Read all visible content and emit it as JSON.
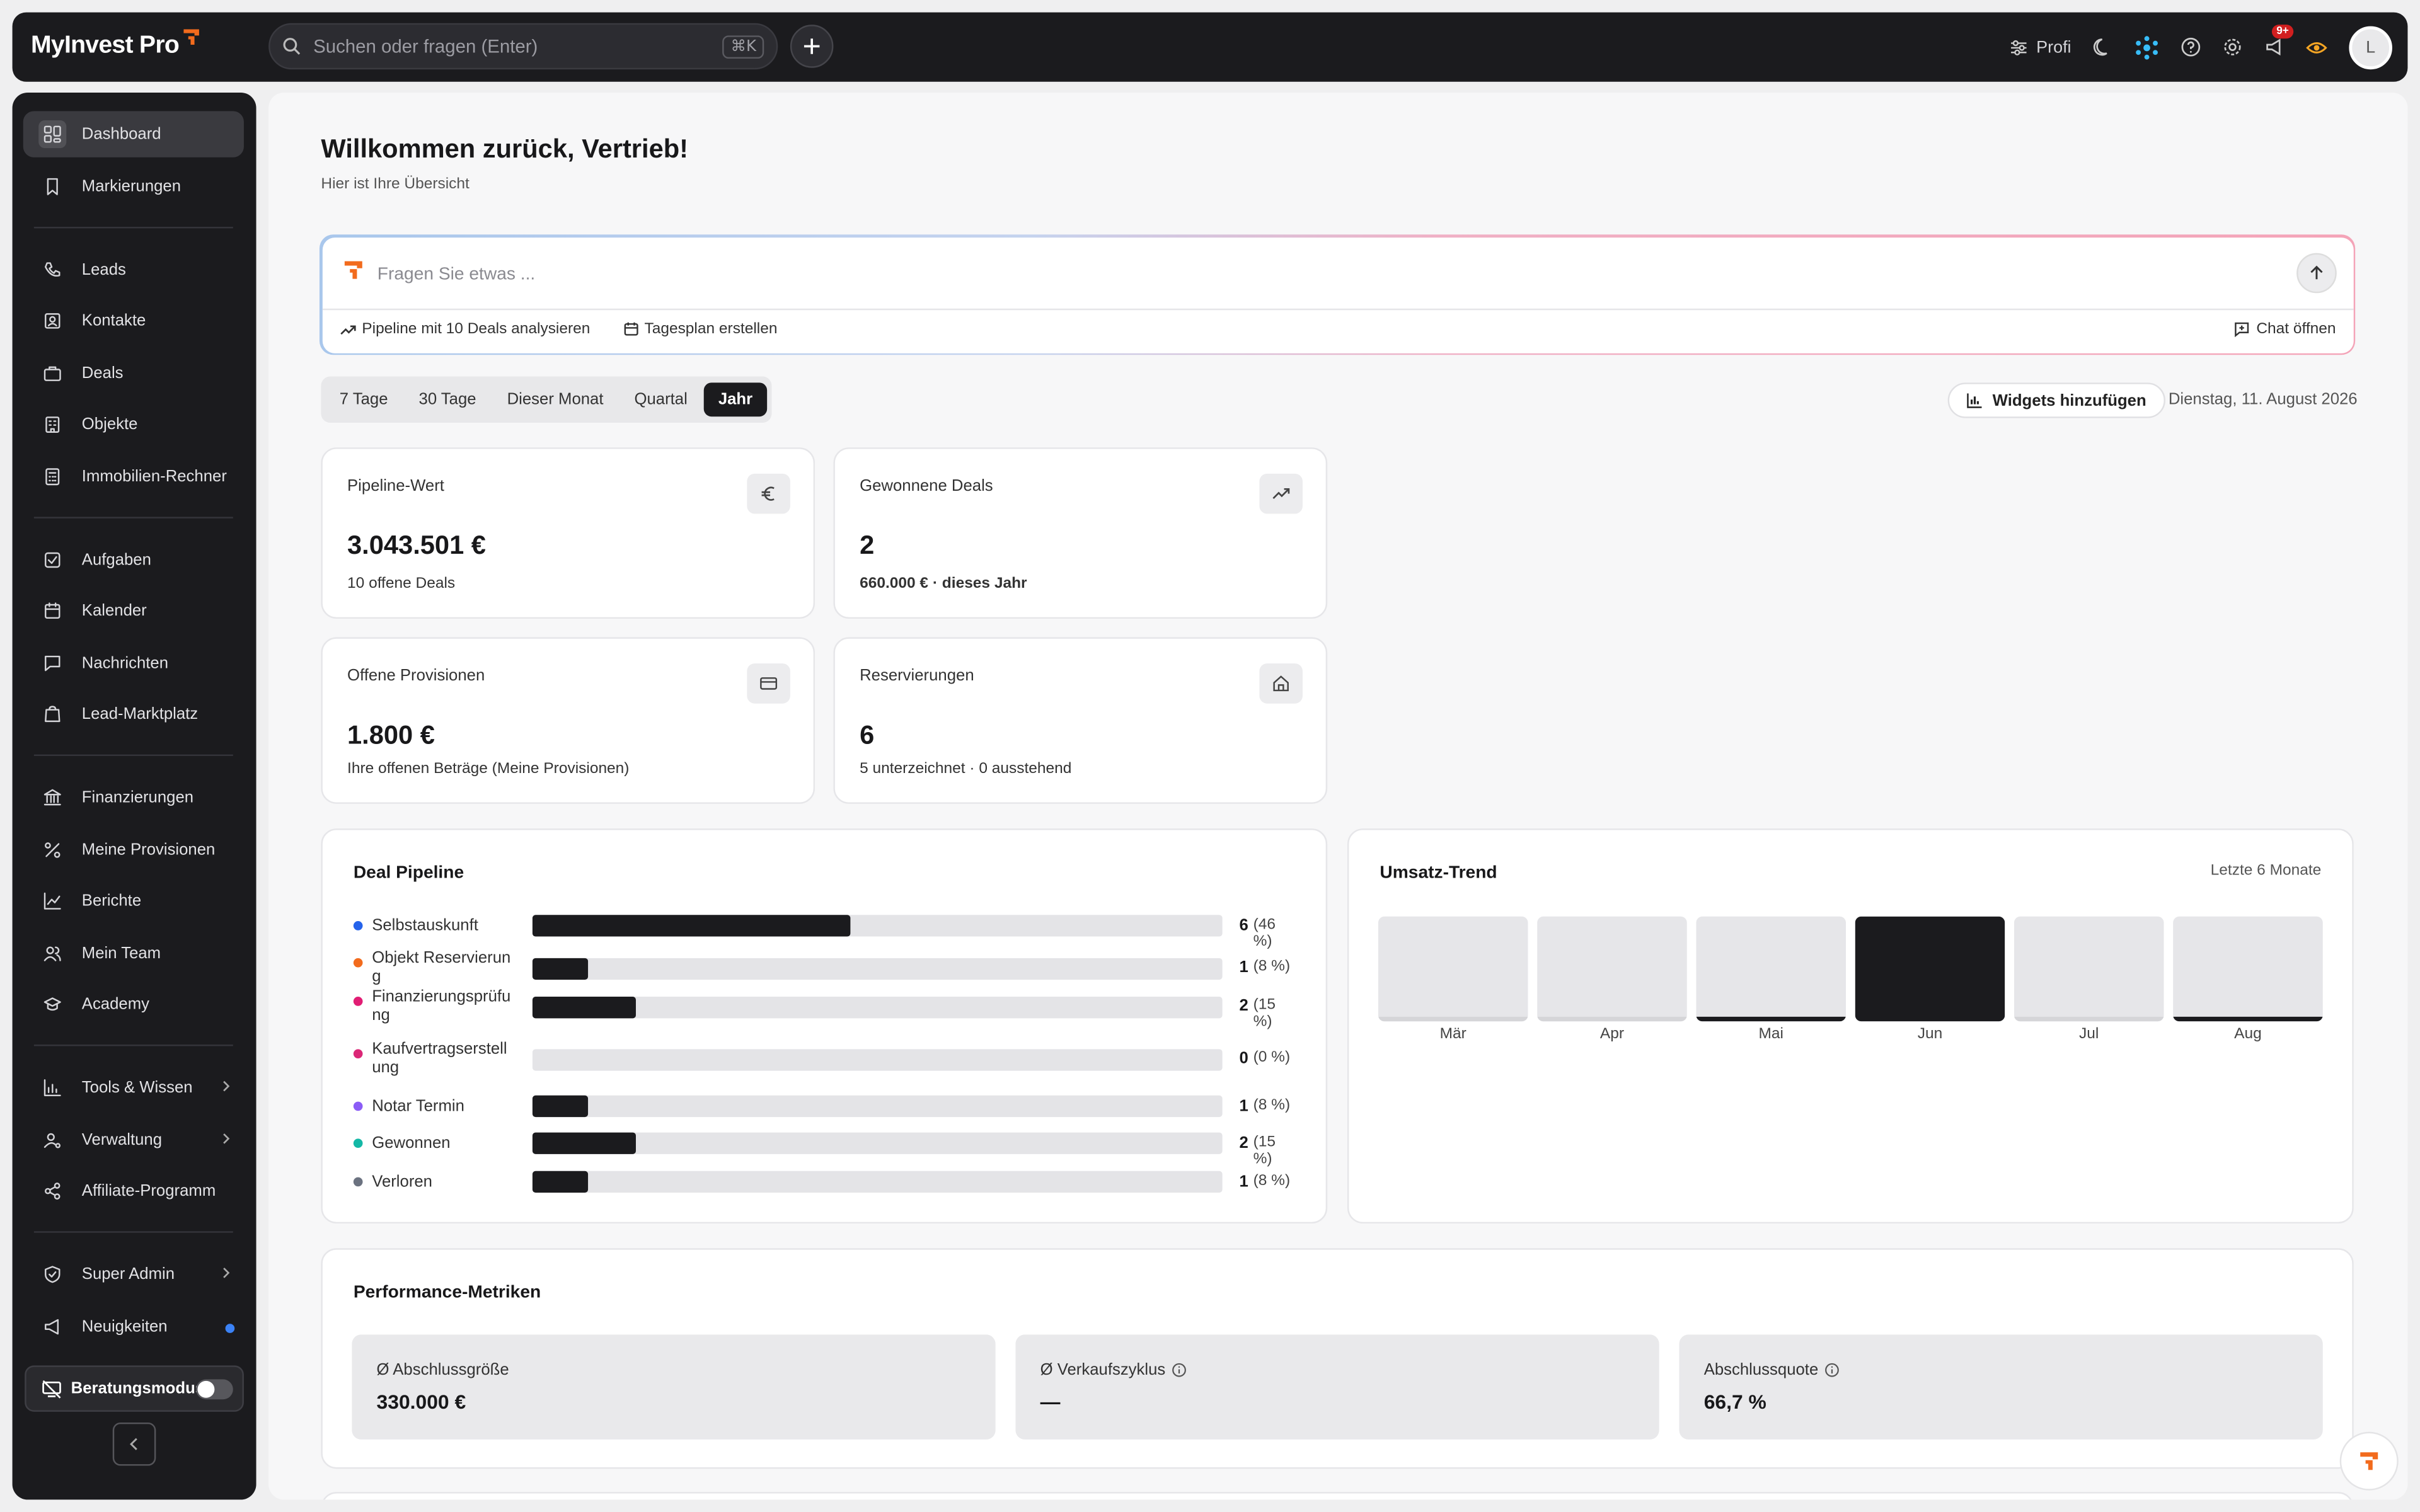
{
  "app": {
    "brand": "MyInvest Pro",
    "accent": "#f26b1d"
  },
  "header": {
    "search_placeholder": "Suchen oder fragen (Enter)",
    "shortcut": "⌘K",
    "profile_mode": "Profi",
    "notification_count": "9+",
    "avatar_initial": "L"
  },
  "sidebar": {
    "groups": [
      [
        {
          "label": "Dashboard",
          "icon": "dashboard-icon",
          "active": true
        },
        {
          "label": "Markierungen",
          "icon": "bookmark-icon"
        }
      ],
      [
        {
          "label": "Leads",
          "icon": "phone-icon"
        },
        {
          "label": "Kontakte",
          "icon": "contact-icon"
        },
        {
          "label": "Deals",
          "icon": "briefcase-icon"
        },
        {
          "label": "Objekte",
          "icon": "building-icon"
        },
        {
          "label": "Immobilien-Rechner",
          "icon": "calculator-icon"
        }
      ],
      [
        {
          "label": "Aufgaben",
          "icon": "task-icon"
        },
        {
          "label": "Kalender",
          "icon": "calendar-icon"
        },
        {
          "label": "Nachrichten",
          "icon": "message-icon"
        },
        {
          "label": "Lead-Marktplatz",
          "icon": "shop-icon"
        }
      ],
      [
        {
          "label": "Finanzierungen",
          "icon": "bank-icon"
        },
        {
          "label": "Meine Provisionen",
          "icon": "percent-icon"
        },
        {
          "label": "Berichte",
          "icon": "chart-icon"
        },
        {
          "label": "Mein Team",
          "icon": "team-icon"
        },
        {
          "label": "Academy",
          "icon": "graduation-icon"
        }
      ],
      [
        {
          "label": "Tools & Wissen",
          "icon": "tools-icon",
          "chevron": true
        },
        {
          "label": "Verwaltung",
          "icon": "user-cog-icon",
          "chevron": true
        },
        {
          "label": "Affiliate-Programm",
          "icon": "share-icon"
        }
      ],
      [
        {
          "label": "Super Admin",
          "icon": "shield-icon",
          "chevron": true
        },
        {
          "label": "Neuigkeiten",
          "icon": "megaphone-icon",
          "dot": true
        }
      ]
    ],
    "consult_mode_label": "Beratungsmodus"
  },
  "main": {
    "title": "Willkommen zurück, Vertrieb!",
    "subtitle": "Hier ist Ihre Übersicht",
    "ai": {
      "placeholder": "Fragen Sie etwas ...",
      "chip1": "Pipeline mit 10 Deals analysieren",
      "chip2": "Tagesplan erstellen",
      "chat_open": "Chat öffnen"
    },
    "ranges": [
      "7 Tage",
      "30 Tage",
      "Dieser Monat",
      "Quartal",
      "Jahr"
    ],
    "active_range": "Jahr",
    "widgets_button": "Widgets hinzufügen",
    "date": "Dienstag, 11. August 2026",
    "kpis": [
      {
        "label": "Pipeline-Wert",
        "value": "3.043.501 €",
        "sub": "10 offene Deals",
        "icon": "euro-icon"
      },
      {
        "label": "Gewonnene Deals",
        "value": "2",
        "sub": "660.000 € · dieses Jahr",
        "icon": "trend-up-icon"
      },
      {
        "label": "Offene Provisionen",
        "value": "1.800 €",
        "sub": "Ihre offenen Beträge (Meine Provisionen)",
        "icon": "card-icon"
      },
      {
        "label": "Reservierungen",
        "value": "6",
        "sub": "5 unterzeichnet · 0 ausstehend",
        "icon": "home-icon"
      }
    ],
    "pipeline": {
      "title": "Deal Pipeline",
      "stages": [
        {
          "label": "Selbstauskunft",
          "count": "6",
          "pct": "(46 %)",
          "fraction": 0.46,
          "color": "#2563eb"
        },
        {
          "label": "Objekt Reservierung",
          "count": "1",
          "pct": "(8 %)",
          "fraction": 0.08,
          "color": "#f26b1d"
        },
        {
          "label": "Finanzierungsprüfung",
          "count": "2",
          "pct": "(15 %)",
          "fraction": 0.15,
          "color": "#e11d74"
        },
        {
          "label": "Kaufvertragserstellung",
          "count": "0",
          "pct": "(0 %)",
          "fraction": 0,
          "color": "#db2777"
        },
        {
          "label": "Notar Termin",
          "count": "1",
          "pct": "(8 %)",
          "fraction": 0.08,
          "color": "#8b5cf6"
        },
        {
          "label": "Gewonnen",
          "count": "2",
          "pct": "(15 %)",
          "fraction": 0.15,
          "color": "#14b8a6"
        },
        {
          "label": "Verloren",
          "count": "1",
          "pct": "(8 %)",
          "fraction": 0.08,
          "color": "#6b7280"
        }
      ]
    },
    "trend": {
      "title": "Umsatz-Trend",
      "subtitle": "Letzte 6 Monate"
    },
    "metrics": {
      "title": "Performance-Metriken",
      "items": [
        {
          "label": "Ø Abschlussgröße",
          "value": "330.000 €",
          "info": false
        },
        {
          "label": "Ø Verkaufszyklus",
          "value": "—",
          "info": true
        },
        {
          "label": "Abschlussquote",
          "value": "66,7 %",
          "info": true
        }
      ]
    }
  },
  "chart_data": {
    "type": "bar",
    "categories": [
      "Mär",
      "Apr",
      "Mai",
      "Jun",
      "Jul",
      "Aug"
    ],
    "values": [
      0,
      0,
      15000,
      660000,
      0,
      15000
    ],
    "ylim": [
      0,
      660000
    ],
    "grid": false,
    "title": "Umsatz-Trend",
    "subtitle": "Letzte 6 Monate"
  }
}
